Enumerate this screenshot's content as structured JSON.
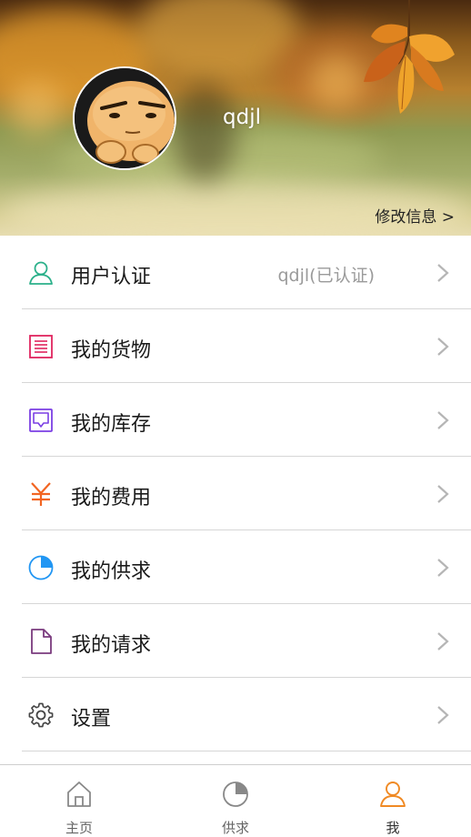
{
  "profile": {
    "username": "qdjl",
    "edit_info_label": "修改信息 >"
  },
  "menu": {
    "items": [
      {
        "label": "用户认证",
        "value": "qdjl(已认证)",
        "icon": "user-icon",
        "color": "#2bb08a"
      },
      {
        "label": "我的货物",
        "value": "",
        "icon": "list-icon",
        "color": "#e0245e"
      },
      {
        "label": "我的库存",
        "value": "",
        "icon": "inbox-icon",
        "color": "#7b3fe4"
      },
      {
        "label": "我的费用",
        "value": "",
        "icon": "yen-icon",
        "color": "#f26522"
      },
      {
        "label": "我的供求",
        "value": "",
        "icon": "pie-icon",
        "color": "#2196f3"
      },
      {
        "label": "我的请求",
        "value": "",
        "icon": "document-icon",
        "color": "#7a3b7e"
      },
      {
        "label": "设置",
        "value": "",
        "icon": "gear-icon",
        "color": "#444444"
      }
    ]
  },
  "tabbar": {
    "tabs": [
      {
        "label": "主页",
        "icon": "home-icon"
      },
      {
        "label": "供求",
        "icon": "pie-icon"
      },
      {
        "label": "我",
        "icon": "user-icon",
        "active": true
      }
    ],
    "active_color": "#f08a24",
    "inactive_color": "#888888"
  }
}
